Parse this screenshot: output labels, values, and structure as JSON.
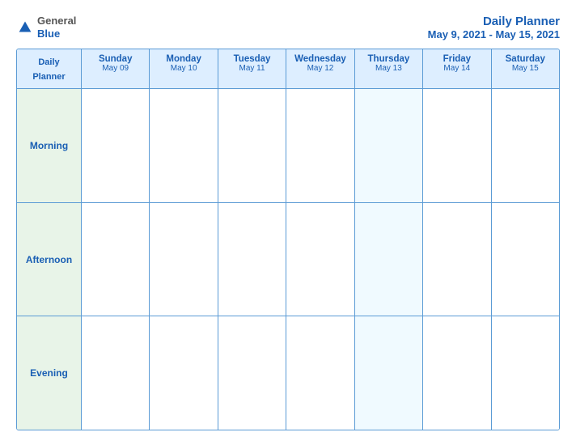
{
  "header": {
    "logo_general": "General",
    "logo_blue": "Blue",
    "title": "Daily Planner",
    "date_range": "May 9, 2021 - May 15, 2021"
  },
  "columns": [
    {
      "id": "label",
      "day": "Daily",
      "day2": "Planner",
      "date": ""
    },
    {
      "id": "sun",
      "day": "Sunday",
      "date": "May 09"
    },
    {
      "id": "mon",
      "day": "Monday",
      "date": "May 10"
    },
    {
      "id": "tue",
      "day": "Tuesday",
      "date": "May 11"
    },
    {
      "id": "wed",
      "day": "Wednesday",
      "date": "May 12"
    },
    {
      "id": "thu",
      "day": "Thursday",
      "date": "May 13"
    },
    {
      "id": "fri",
      "day": "Friday",
      "date": "May 14"
    },
    {
      "id": "sat",
      "day": "Saturday",
      "date": "May 15"
    }
  ],
  "rows": [
    {
      "id": "morning",
      "label": "Morning"
    },
    {
      "id": "afternoon",
      "label": "Afternoon"
    },
    {
      "id": "evening",
      "label": "Evening"
    }
  ]
}
